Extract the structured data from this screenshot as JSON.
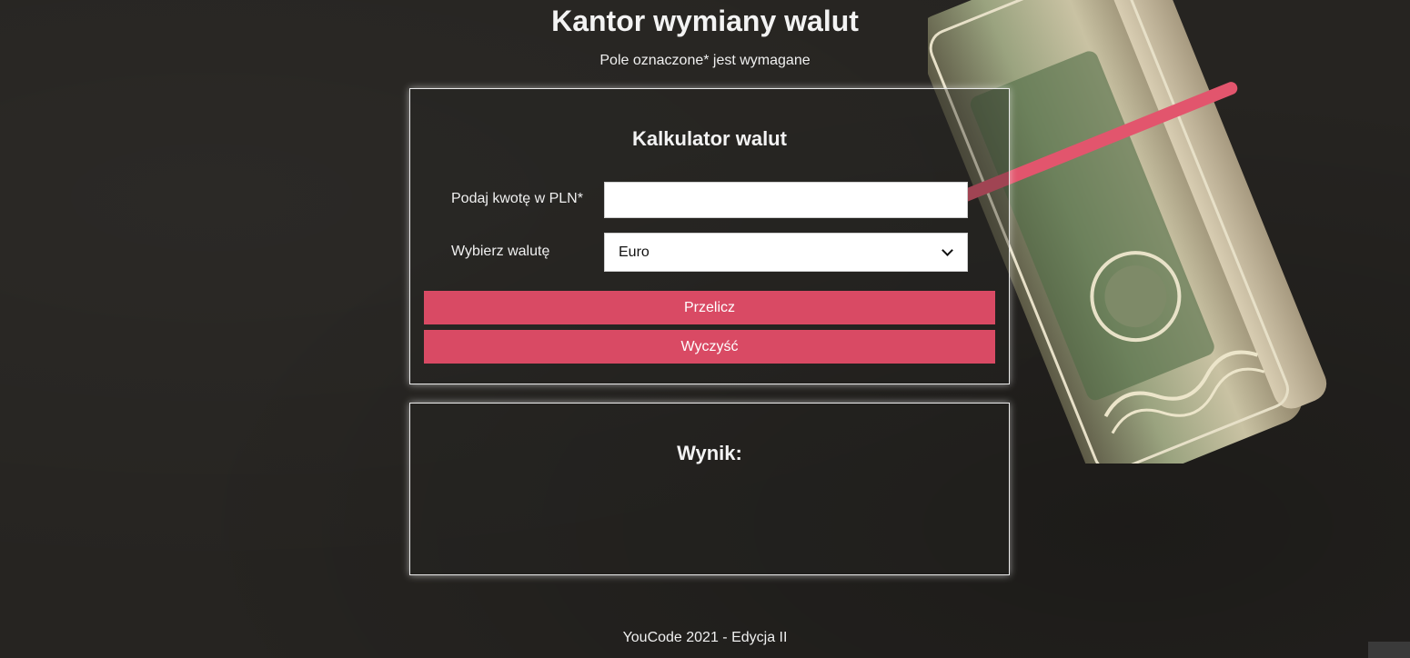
{
  "header": {
    "title": "Kantor wymiany walut",
    "subtitle": "Pole oznaczone* jest wymagane"
  },
  "calculator": {
    "title": "Kalkulator walut",
    "amount_label": "Podaj kwotę w PLN*",
    "amount_value": "",
    "currency_label": "Wybierz walutę",
    "currency_selected": "Euro",
    "calculate_label": "Przelicz",
    "clear_label": "Wyczyść"
  },
  "result": {
    "title": "Wynik:"
  },
  "footer": {
    "text": "YouCode 2021 - Edycja II"
  },
  "colors": {
    "background": "#262421",
    "accent": "#d94a64",
    "card_border": "#eaeaea"
  },
  "icons": {
    "select_arrow": "chevron-down-icon",
    "decoration": "money-roll-image"
  }
}
